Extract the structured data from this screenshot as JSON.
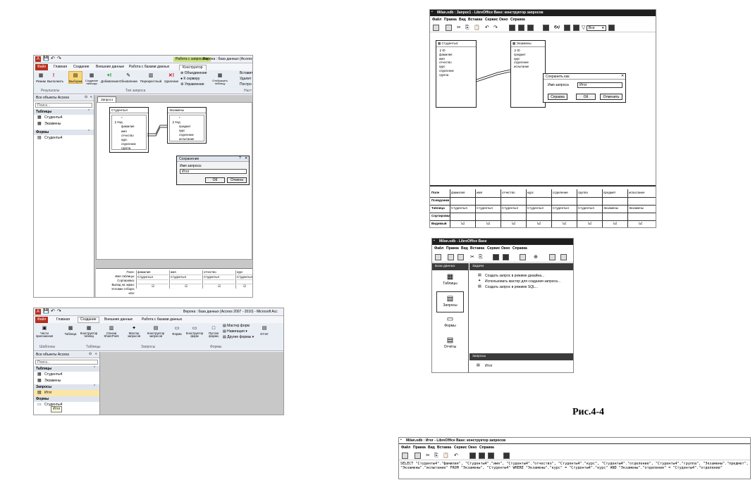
{
  "caption": "Рис.4-4",
  "access1": {
    "title": "Верона : база данных (Access",
    "contextual_tab": "Работа с запросами",
    "tabs": [
      "Файл",
      "Главная",
      "Создание",
      "Внешние данные",
      "Работа с базами данных",
      "Конструктор"
    ],
    "ribbon_buttons": [
      "Режим",
      "Выполнить",
      "Выборка",
      "Создание таблицы",
      "Добавление",
      "Обновление",
      "Перекрестный",
      "Удаление"
    ],
    "ribbon_small": [
      "Объединение",
      "К серверу",
      "Управление"
    ],
    "show_table": "Отобразить таблицу",
    "ribbon_right": [
      "Вставит",
      "Удалит",
      "Постро"
    ],
    "groups": [
      "Результаты",
      "Тип запроса",
      "Наст"
    ],
    "nav_header": "Все объекты Access",
    "search": "Поиск...",
    "nav_sections": [
      {
        "label": "Таблицы",
        "items": [
          "Студенты4",
          "Экзамены"
        ]
      },
      {
        "label": "Формы",
        "items": [
          "Студенты4"
        ]
      }
    ],
    "doc_tab": "Запрос1",
    "table1": {
      "name": "Студенты4",
      "fields": [
        "*",
        "Код",
        "фамилия",
        "имя",
        "отчество",
        "курс",
        "отделение",
        "группа"
      ]
    },
    "table2": {
      "name": "Экзамены",
      "fields": [
        "*",
        "Код",
        "предмет",
        "курс",
        "отделение",
        "испытание"
      ]
    },
    "dialog": {
      "title": "Сохранение",
      "label": "Имя запроса:",
      "value": "Итог",
      "ok": "ОК",
      "cancel": "Отмена"
    },
    "grid_rows": [
      "Поле:",
      "Имя таблицы:",
      "Сортировка:",
      "Вывод на экран:",
      "Условие отбора:",
      "или:"
    ],
    "grid_cols": [
      {
        "field": "фамилия",
        "table": "Студенты4"
      },
      {
        "field": "имя",
        "table": "Студенты4"
      },
      {
        "field": "отчество",
        "table": "Студенты4"
      },
      {
        "field": "курс",
        "table": "Студенты4"
      }
    ]
  },
  "access2": {
    "title": "Верона : база данных (Access 2007 - 2010)  -  Microsoft Acc",
    "tabs": [
      "Файл",
      "Главная",
      "Создание",
      "Внешние данные",
      "Работа с базами данных"
    ],
    "ribbon_buttons": [
      "Части приложения",
      "Таблица",
      "Конструктор таблиц",
      "Списки SharePoint",
      "Мастер запросов",
      "Конструктор запросов",
      "Форма",
      "Конструктор форм",
      "Пустая форма",
      "Отчет"
    ],
    "ribbon_small": [
      "Мастер форм",
      "Навигация",
      "Другие формы"
    ],
    "groups": [
      "Шаблоны",
      "Таблицы",
      "Запросы",
      "Формы"
    ],
    "nav_header": "Все объекты Access",
    "search": "Поиск...",
    "nav_sections": [
      {
        "label": "Таблицы",
        "items": [
          "Студенты4",
          "Экзамены"
        ]
      },
      {
        "label": "Запросы",
        "items": [
          "Итог"
        ]
      },
      {
        "label": "Формы",
        "items": [
          "Студенты4"
        ]
      }
    ],
    "tooltip": "Итог"
  },
  "lo1": {
    "title": "Milan.odb : Запрос1 - LibreOffice Base: конструктор запросов",
    "menu": [
      "Файл",
      "Правка",
      "Вид",
      "Вставка",
      "Сервис",
      "Окно",
      "Справка"
    ],
    "combo": "Все",
    "table1": {
      "name": "Студенты4",
      "fields": [
        "ID",
        "фамилия",
        "имя",
        "отчество",
        "курс",
        "отделение",
        "группа"
      ]
    },
    "table2": {
      "name": "Экзамены",
      "fields": [
        "ID",
        "предмет",
        "курс",
        "отделение",
        "испытание"
      ]
    },
    "dialog": {
      "title": "Сохранить как",
      "label": "Имя запроса",
      "value": "Итог",
      "help": "Справка",
      "ok": "ОК",
      "cancel": "Отменить"
    },
    "grid_rows": [
      "Поле",
      "Псевдоним",
      "Таблица",
      "Сортировка",
      "Видимый"
    ],
    "grid_fields": [
      "фамилия",
      "имя",
      "отчество",
      "курс",
      "отделение",
      "группа",
      "предмет",
      "испытание"
    ],
    "grid_tables": [
      "Студенты4",
      "Студенты4",
      "Студенты4",
      "Студенты4",
      "Студенты4",
      "Студенты4",
      "Экзамены",
      "Экзамены"
    ],
    "check": "☑"
  },
  "lo2": {
    "title": "Milan.odb - LibreOffice Base",
    "menu": [
      "Файл",
      "Правка",
      "Вид",
      "Вставка",
      "Сервис",
      "Окно",
      "Справка"
    ],
    "db_header": "База данных",
    "tasks_header": "Задачи",
    "sidebar": [
      "Таблицы",
      "Запросы",
      "Формы",
      "Отчёты"
    ],
    "tasks": [
      "Создать запрос в режиме дизайна...",
      "Использовать мастер для создания запроса...",
      "Создать запрос в режиме SQL..."
    ],
    "queries_header": "Запросы",
    "queries": [
      "Итог"
    ]
  },
  "lo3": {
    "title": "Milan.odb : Итог - LibreOffice Base: конструктор запросов",
    "menu": [
      "Файл",
      "Правка",
      "Вид",
      "Вставка",
      "Сервис",
      "Окно",
      "Справка"
    ],
    "sql": "SELECT \"Студенты4\".\"фамилия\", \"Студенты4\".\"имя\", \"Студенты4\".\"отчество\", \"Студенты4\".\"курс\", \"Студенты4\".\"отделение\", \"Студенты4\".\"группа\", \"Экзамены\".\"предмет\", \"Экзамены\".\"испытание\" FROM \"Экзамены\", \"Студенты4\" WHERE \"Экзамены\".\"курс\" = \"Студенты4\".\"курс\" AND \"Экзамены\".\"отделение\" = \"Студенты4\".\"отделение\""
  },
  "colors": {
    "access_file_tab": "#b72f1f",
    "access_ribbon": "#e9eef5",
    "access_contextual": "#c7e07a",
    "access_grey": "#c8c8c8",
    "lo_title": "#1f1f1f"
  }
}
